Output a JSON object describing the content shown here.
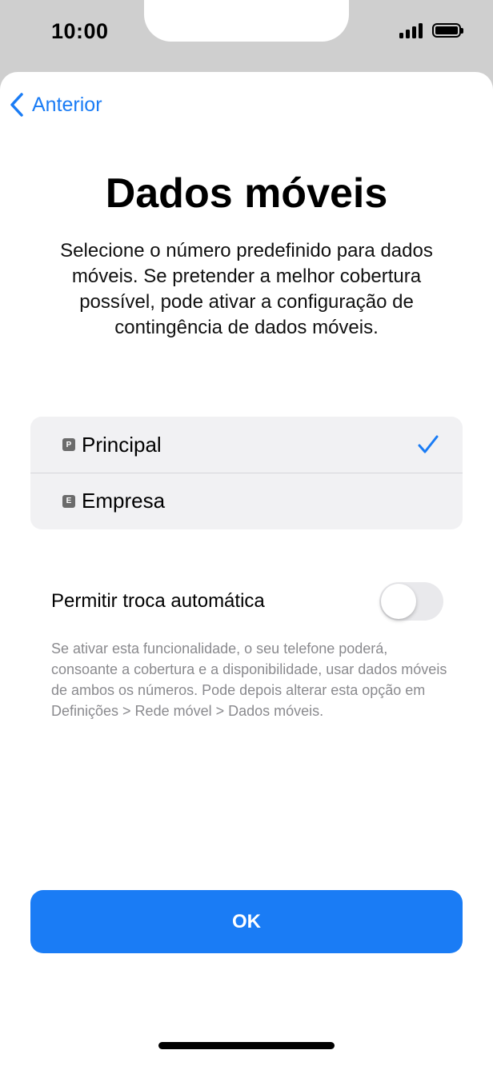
{
  "status_bar": {
    "time": "10:00",
    "signal_icon": "cellular-signal-icon",
    "battery_icon": "battery-icon"
  },
  "nav": {
    "back_label": "Anterior",
    "back_icon": "chevron-left-icon"
  },
  "page": {
    "title": "Dados móveis",
    "subtitle": "Selecione o número predefinido para dados móveis. Se pretender a melhor cobertura possível, pode ativar a configuração de contingência de dados móveis."
  },
  "lines": [
    {
      "badge": "P",
      "label": "Principal",
      "selected": true
    },
    {
      "badge": "E",
      "label": "Empresa",
      "selected": false
    }
  ],
  "auto_switch": {
    "label": "Permitir troca automática",
    "enabled": false,
    "footnote": "Se ativar esta funcionalidade, o seu telefone poderá, consoante a cobertura e a disponibilidade, usar dados móveis de ambos os números. Pode depois alterar esta opção em Definições > Rede móvel > Dados móveis."
  },
  "primary_action": {
    "label": "OK"
  },
  "colors": {
    "accent": "#1a7cf5",
    "header_bg": "#cfcfcf",
    "group_bg": "#f1f1f3",
    "footnote": "#8a8a8e"
  }
}
